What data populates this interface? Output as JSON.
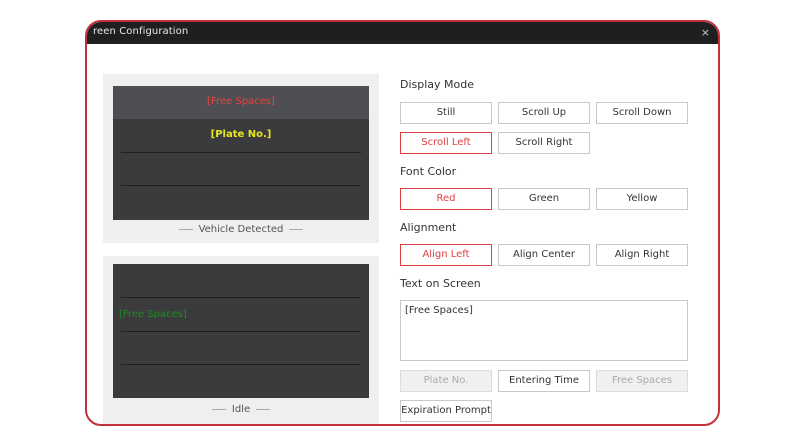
{
  "window": {
    "title": "reen Configuration",
    "close": "×"
  },
  "previews": {
    "vehicle_detected": {
      "line1": "[Free Spaces]",
      "line2": "[Plate No.]",
      "caption": "Vehicle Detected"
    },
    "idle": {
      "line1": "[Free Spaces]",
      "caption": "Idle"
    }
  },
  "display_mode": {
    "label": "Display Mode",
    "options": [
      "Still",
      "Scroll Up",
      "Scroll Down",
      "Scroll Left",
      "Scroll Right"
    ],
    "selected": "Scroll Left"
  },
  "font_color": {
    "label": "Font Color",
    "options": [
      "Red",
      "Green",
      "Yellow"
    ],
    "selected": "Red"
  },
  "alignment": {
    "label": "Alignment",
    "options": [
      "Align Left",
      "Align Center",
      "Align Right"
    ],
    "selected": "Align Left"
  },
  "text_on_screen": {
    "label": "Text on Screen",
    "value": "[Free Spaces]"
  },
  "insert_buttons": {
    "plate_no": "Plate No.",
    "entering_time": "Entering Time",
    "free_spaces": "Free Spaces",
    "expiration_prompt": "Expiration Prompt"
  },
  "colors": {
    "accent": "#e04040",
    "frame": "#c4313a",
    "screen_bg": "#3b3b3e"
  }
}
